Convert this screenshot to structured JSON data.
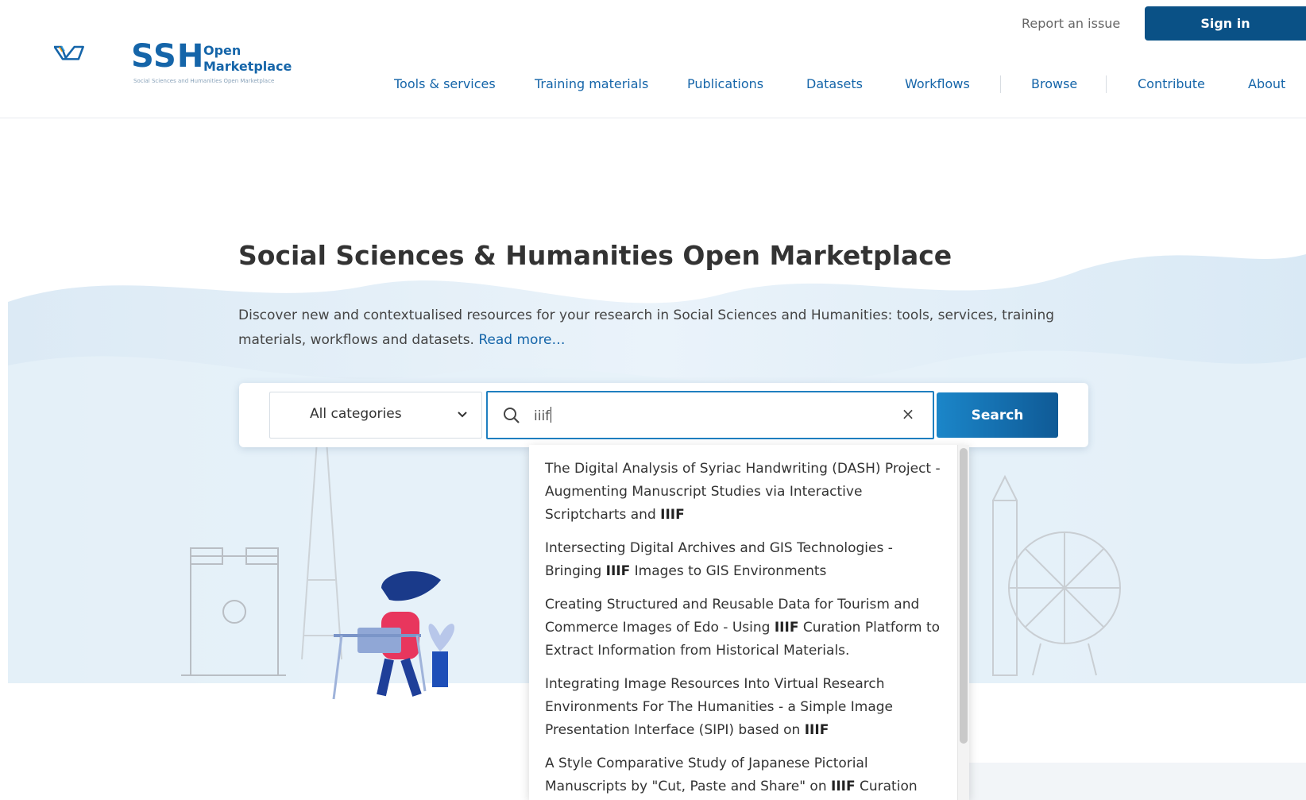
{
  "header": {
    "logo": {
      "word": "SSH",
      "open": "Open",
      "marketplace": "Marketplace",
      "tagline": "Social Sciences and Humanities Open Marketplace"
    },
    "report_issue": "Report an issue",
    "sign_in": "Sign in",
    "nav": [
      "Tools & services",
      "Training materials",
      "Publications",
      "Datasets",
      "Workflows",
      "Browse",
      "Contribute",
      "About"
    ]
  },
  "hero": {
    "title": "Social Sciences & Humanities Open Marketplace",
    "description": "Discover new and contextualised resources for your research in Social Sciences and Humanities: tools, services, training materials, workflows and datasets.",
    "read_more": "Read more…"
  },
  "search": {
    "category_selected": "All categories",
    "query": "iiif",
    "clear_symbol": "×",
    "button": "Search"
  },
  "suggestions": [
    {
      "before": "The Digital Analysis of Syriac Handwriting (DASH) Project - Augmenting Manuscript Studies via Interactive Scriptcharts and ",
      "match": "IIIF",
      "after": ""
    },
    {
      "before": "Intersecting Digital Archives and GIS Technologies - Bringing ",
      "match": "IIIF",
      "after": " Images to GIS Environments"
    },
    {
      "before": "Creating Structured and Reusable Data for Tourism and Commerce Images of Edo - Using ",
      "match": "IIIF",
      "after": " Curation Platform to Extract Information from Historical Materials."
    },
    {
      "before": "Integrating Image Resources Into Virtual Research Environments For The Humanities - a Simple Image Presentation Interface (SIPI) based on ",
      "match": "IIIF",
      "after": ""
    },
    {
      "before": "A Style Comparative Study of Japanese Pictorial Manuscripts by \"Cut, Paste and Share\" on ",
      "match": "IIIF",
      "after": " Curation Viewer"
    }
  ],
  "colors": {
    "brand": "#1565a9",
    "sign_in_bg": "#0a5186",
    "search_border": "#1f7fc0"
  },
  "icons": {
    "search": "search-icon",
    "dropdown": "chevron-down-icon",
    "clear": "close-icon"
  }
}
